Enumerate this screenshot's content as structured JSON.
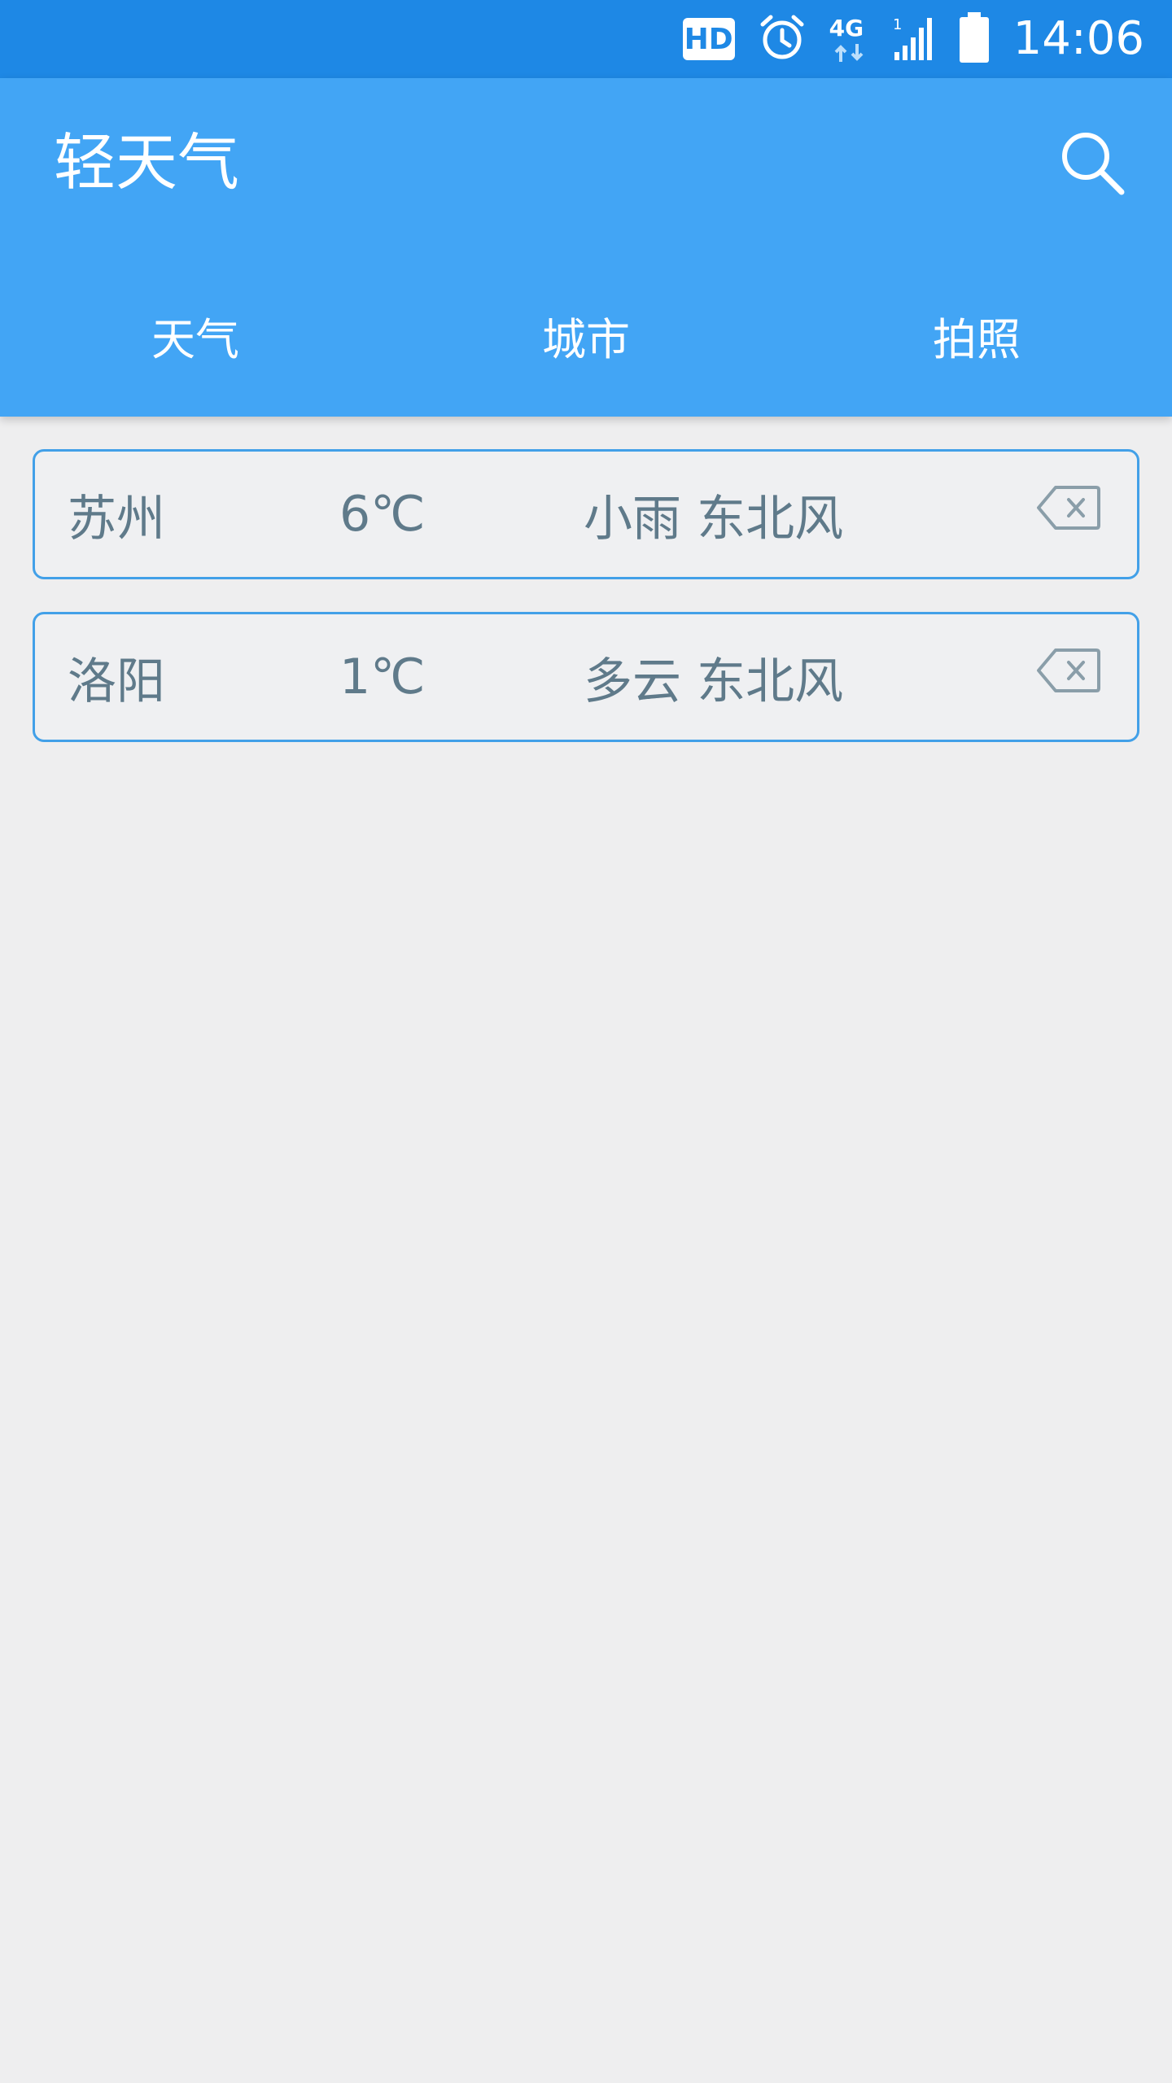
{
  "status_bar": {
    "hd_label": "HD",
    "network_label": "4G",
    "time": "14:06"
  },
  "app": {
    "title": "轻天气"
  },
  "tabs": [
    {
      "label": "天气"
    },
    {
      "label": "城市"
    },
    {
      "label": "拍照"
    }
  ],
  "cities": [
    {
      "name": "苏州",
      "temp": "6℃",
      "condition": "小雨 东北风"
    },
    {
      "name": "洛阳",
      "temp": "1℃",
      "condition": "多云 东北风"
    }
  ],
  "colors": {
    "status_bar": "#1e88e5",
    "app_bar": "#42a5f5",
    "card_border": "#42a0e8",
    "card_text": "#5f7a8a",
    "background": "#eeeeef"
  },
  "icons": {
    "search": "search-icon",
    "delete": "backspace-icon",
    "alarm": "alarm-icon",
    "signal": "signal-icon",
    "battery": "battery-icon"
  }
}
